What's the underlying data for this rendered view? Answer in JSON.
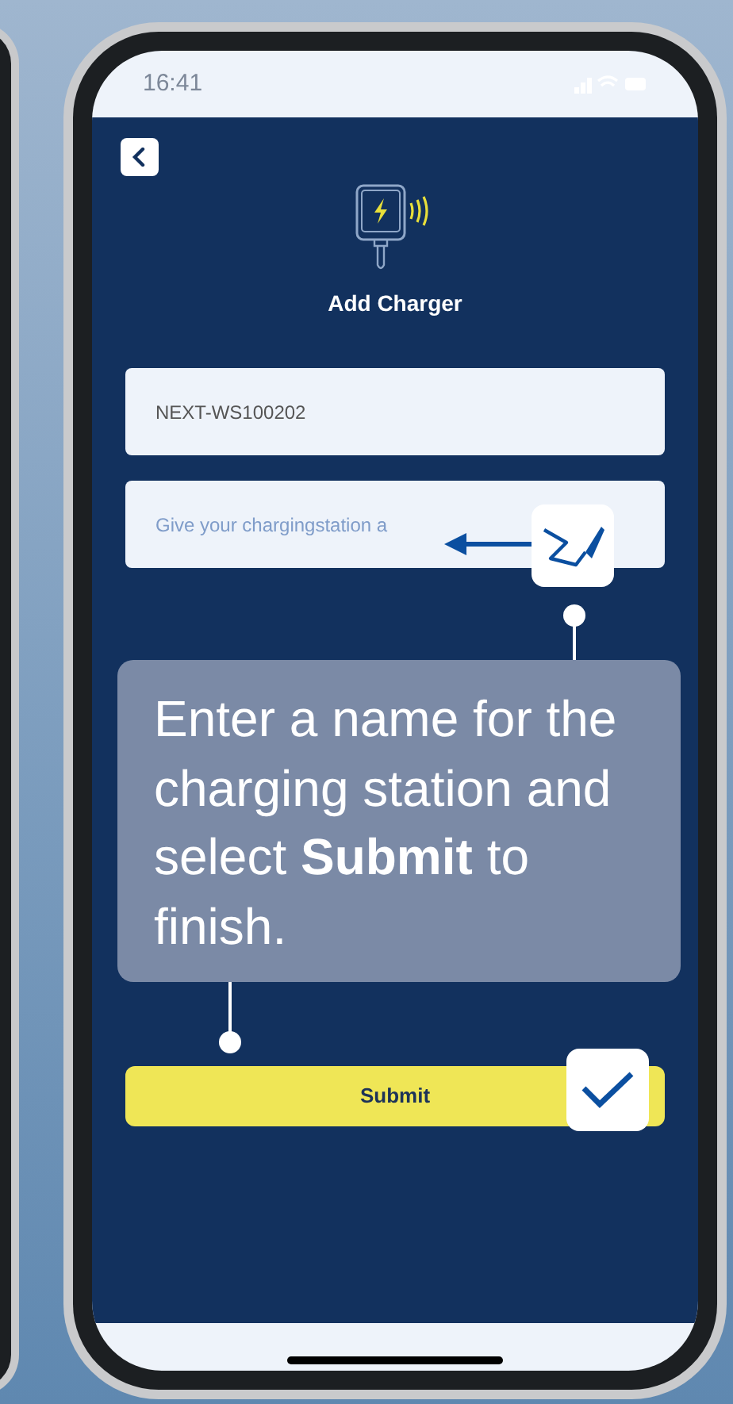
{
  "status_bar": {
    "time": "16:41"
  },
  "screen": {
    "title": "Add Charger",
    "fields": [
      {
        "kind": "value",
        "text": "NEXT-WS100202"
      },
      {
        "kind": "empty",
        "placeholder": "Give your chargingstation a"
      }
    ],
    "submit": {
      "label": "Submit"
    }
  },
  "callout": {
    "text": "Enter a name for the charging station and select **Submit** to finish."
  }
}
